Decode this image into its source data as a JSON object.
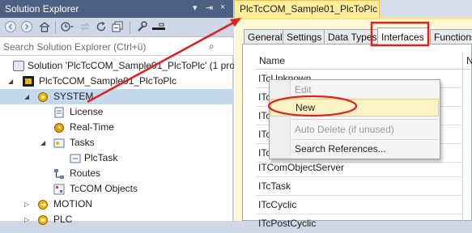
{
  "solution_explorer": {
    "title": "Solution Explorer",
    "pin": "⇥",
    "close": "×",
    "dropdown": "▾",
    "search_placeholder": "Search Solution Explorer (Ctrl+ü)",
    "search_icon": "⌕",
    "tree": [
      {
        "label": "Solution 'PlcTcCOM_Sample01_PlcToPlc' (1 pro",
        "arrow": "",
        "icon": "solution"
      },
      {
        "label": "PlcTcCOM_Sample01_PlcToPlc",
        "arrow": "◢",
        "icon": "project"
      },
      {
        "label": "SYSTEM",
        "arrow": "◢",
        "icon": "gear",
        "selected": true
      },
      {
        "label": "License",
        "arrow": "",
        "icon": "license"
      },
      {
        "label": "Real-Time",
        "arrow": "",
        "icon": "realtime"
      },
      {
        "label": "Tasks",
        "arrow": "◢",
        "icon": "tasks"
      },
      {
        "label": "PlcTask",
        "arrow": "",
        "icon": "task"
      },
      {
        "label": "Routes",
        "arrow": "",
        "icon": "routes"
      },
      {
        "label": "TcCOM Objects",
        "arrow": "",
        "icon": "tccom"
      },
      {
        "label": "MOTION",
        "arrow": "▷",
        "icon": "motion"
      },
      {
        "label": "PLC",
        "arrow": "▷",
        "icon": "plc"
      }
    ]
  },
  "editor": {
    "tab_title": "PlcTcCOM_Sample01_PlcToPlc",
    "tab_close": "×",
    "tabs": [
      "General",
      "Settings",
      "Data Types",
      "Interfaces",
      "Functions"
    ],
    "active_tab": "Interfaces",
    "column_name": "Name",
    "column_second": "N",
    "rows": [
      "ITcUnknown",
      "ITcPersist",
      "ITcCom",
      "ITcFunctions",
      "ITcTaskJob",
      "ITComObjectServer",
      "ITcTask",
      "ITcCyclic",
      "ITcPostCyclic"
    ]
  },
  "context_menu": {
    "items": [
      {
        "label": "Edit",
        "enabled": false
      },
      {
        "label": "New",
        "enabled": true,
        "highlighted": true
      },
      {
        "label": "Auto Delete (if unused)",
        "enabled": false
      },
      {
        "label": "Search References...",
        "enabled": true
      }
    ]
  },
  "colors": {
    "title_bar": "#4d6082",
    "annotation_red": "#e02020",
    "active_doc_tab": "#ffef9d"
  }
}
